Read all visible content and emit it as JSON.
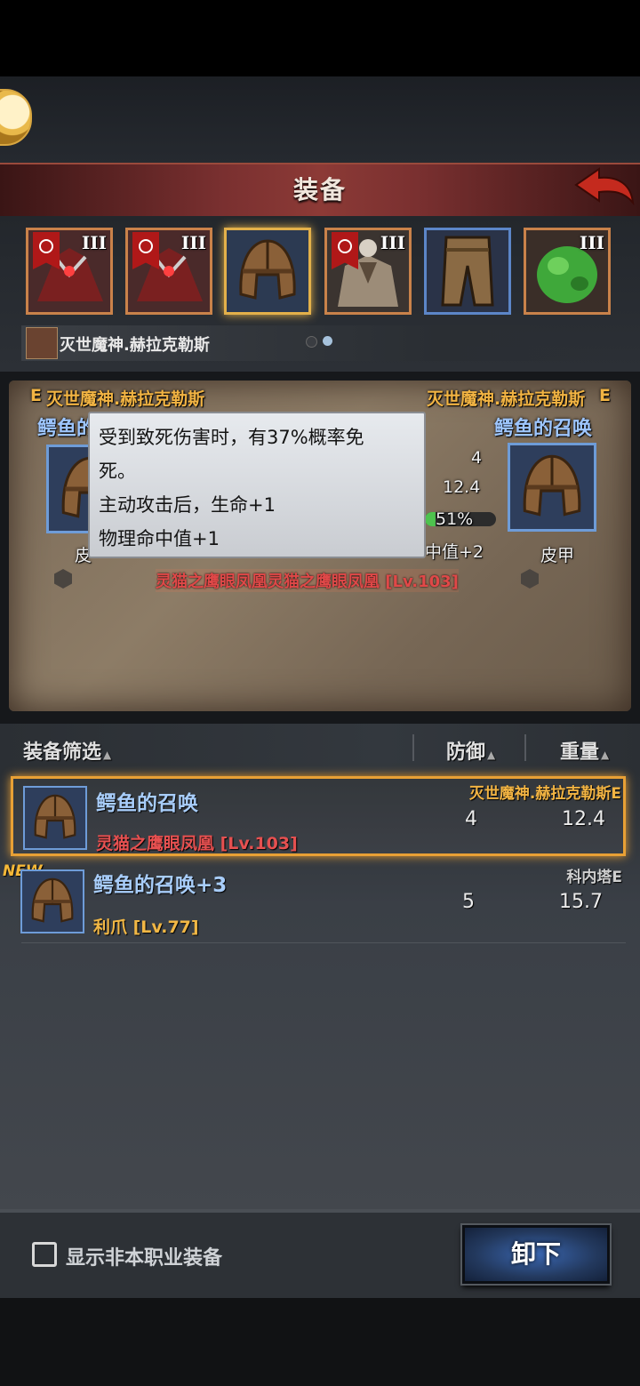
{
  "title": "装备",
  "slots": [
    {
      "rank": "III"
    },
    {
      "rank": "III"
    },
    {
      "rank": ""
    },
    {
      "rank": "III"
    },
    {
      "rank": ""
    },
    {
      "rank": "III"
    }
  ],
  "owner_name": "灭世魔神.赫拉克勒斯",
  "compare": {
    "left": {
      "grade": "E",
      "owner": "灭世魔神.赫拉克勒斯",
      "item_name": "鳄鱼的",
      "type": "皮"
    },
    "right": {
      "grade": "E",
      "owner": "灭世魔神.赫拉克勒斯",
      "item_name": "鳄鱼的召唤",
      "type": "皮甲"
    },
    "stats": {
      "defense": "4",
      "weight": "12.4",
      "percent": "51%",
      "hit_tail": "中值+2"
    },
    "set_name": "灵猫之鹰眼凤凰灵猫之鹰眼凤凰 [Lv.103]"
  },
  "tooltip": {
    "line1": "受到致死伤害时，有37%概率免",
    "line2": "死。",
    "line3": "主动攻击后，生命+1",
    "line4": "物理命中值+1"
  },
  "list_header": {
    "filter": "装备筛选",
    "defense": "防御",
    "weight": "重量"
  },
  "items": [
    {
      "name": "鳄鱼的召唤",
      "set": "灵猫之鹰眼凤凰 [Lv.103]",
      "owner": "灭世魔神.赫拉克勒斯E",
      "defense": "4",
      "weight": "12.4"
    },
    {
      "name": "鳄鱼的召唤+3",
      "set": "利爪 [Lv.77]",
      "owner": "科内塔E",
      "defense": "5",
      "weight": "15.7",
      "badge": "NEW"
    }
  ],
  "footer": {
    "show_other_label": "显示非本职业装备",
    "unequip_label": "卸下"
  }
}
